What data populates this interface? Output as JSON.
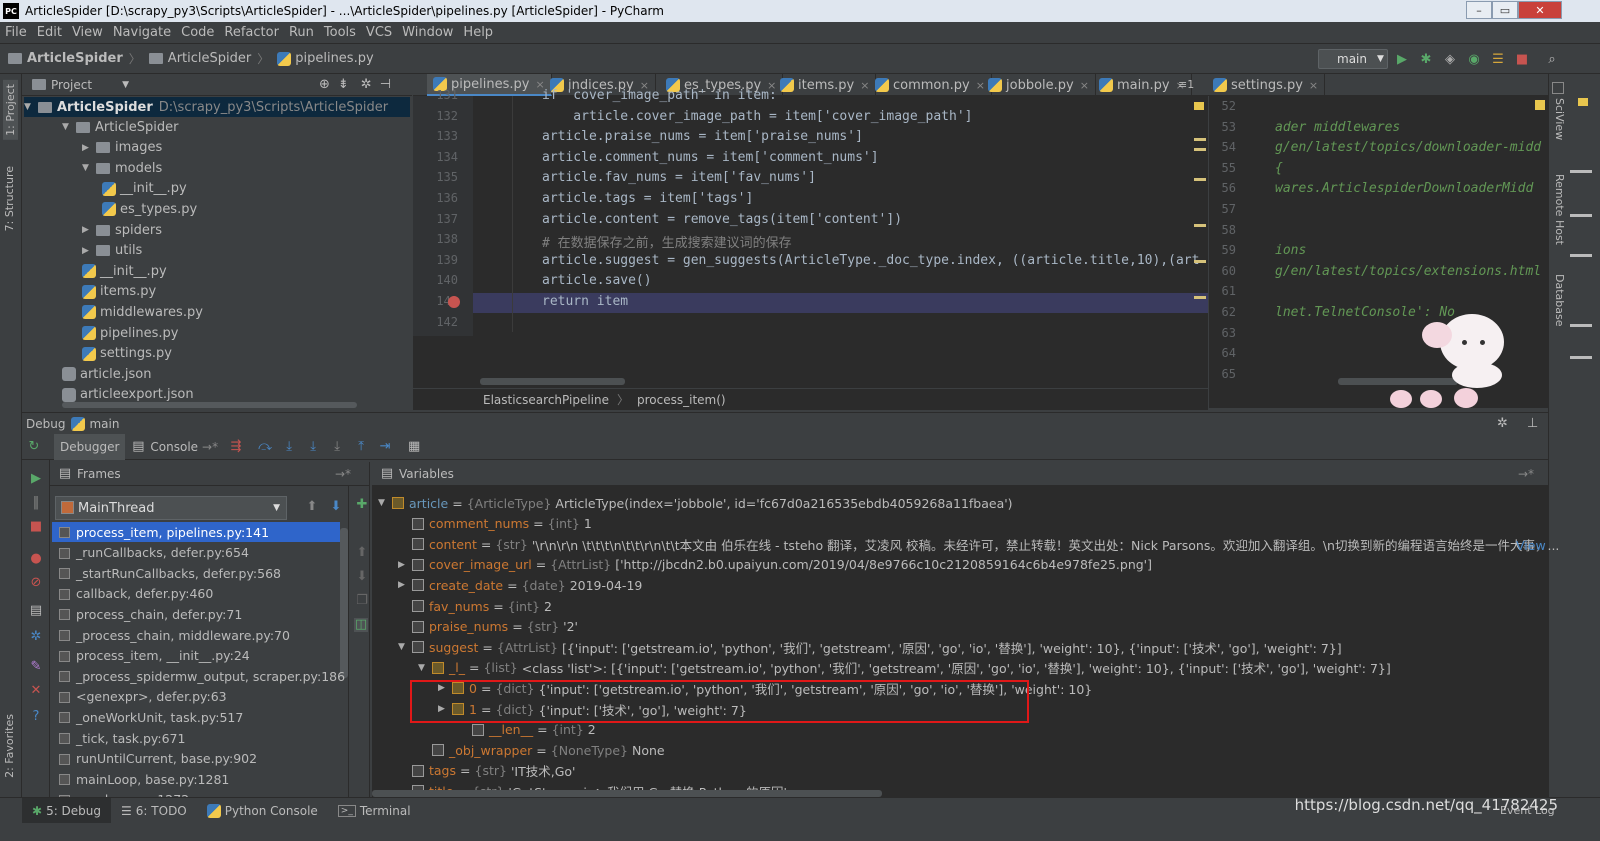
{
  "window": {
    "title": "ArticleSpider [D:\\scrapy_py3\\Scripts\\ArticleSpider] - ...\\ArticleSpider\\pipelines.py [ArticleSpider] - PyCharm",
    "logo": "PC"
  },
  "menu": [
    "File",
    "Edit",
    "View",
    "Navigate",
    "Code",
    "Refactor",
    "Run",
    "Tools",
    "VCS",
    "Window",
    "Help"
  ],
  "breadcrumb": [
    "ArticleSpider",
    "ArticleSpider",
    "pipelines.py"
  ],
  "run_config": "main",
  "left_tool_tabs": [
    "1: Project",
    "7: Structure",
    "2: Favorites"
  ],
  "right_tool_tabs": [
    "SciView",
    "Remote Host",
    "Database"
  ],
  "project": {
    "header": "Project",
    "root_name": "ArticleSpider",
    "root_path": "D:\\scrapy_py3\\Scripts\\ArticleSpider",
    "items": [
      {
        "name": "ArticleSpider",
        "kind": "folder",
        "expanded": true
      },
      {
        "name": "images",
        "kind": "folder",
        "expanded": false
      },
      {
        "name": "models",
        "kind": "folder",
        "expanded": true
      },
      {
        "name": "__init__.py",
        "kind": "py"
      },
      {
        "name": "es_types.py",
        "kind": "py"
      },
      {
        "name": "spiders",
        "kind": "folder",
        "expanded": false
      },
      {
        "name": "utils",
        "kind": "folder",
        "expanded": false
      },
      {
        "name": "__init__.py",
        "kind": "py"
      },
      {
        "name": "items.py",
        "kind": "py"
      },
      {
        "name": "middlewares.py",
        "kind": "py"
      },
      {
        "name": "pipelines.py",
        "kind": "py"
      },
      {
        "name": "settings.py",
        "kind": "py"
      },
      {
        "name": "article.json",
        "kind": "json"
      },
      {
        "name": "articleexport.json",
        "kind": "json"
      }
    ]
  },
  "editor_tabs": [
    "pipelines.py",
    "indices.py",
    "es_types.py",
    "items.py",
    "common.py",
    "jobbole.py",
    "main.py",
    "settings.py"
  ],
  "editor_tabs_overflow": "1",
  "code": {
    "lines": [
      {
        "num": "131",
        "text": "if 'cover_image_path' in item:"
      },
      {
        "num": "132",
        "text": "    article.cover_image_path = item['cover_image_path']"
      },
      {
        "num": "133",
        "text": "article.praise_nums = item['praise_nums']"
      },
      {
        "num": "134",
        "text": "article.comment_nums = item['comment_nums']"
      },
      {
        "num": "135",
        "text": "article.fav_nums = item['fav_nums']"
      },
      {
        "num": "136",
        "text": "article.tags = item['tags']"
      },
      {
        "num": "137",
        "text": "article.content = remove_tags(item['content'])"
      },
      {
        "num": "138",
        "text": "# 在数据保存之前，生成搜索建议词的保存"
      },
      {
        "num": "139",
        "text": "article.suggest = gen_suggests(ArticleType._doc_type.index, ((article.title,10),(art"
      },
      {
        "num": "140",
        "text": "article.save()"
      },
      {
        "num": "141",
        "text": "return item"
      },
      {
        "num": "142",
        "text": ""
      }
    ],
    "breadcrumb": [
      "ElasticsearchPipeline",
      "process_item()"
    ]
  },
  "right_code": {
    "lines": [
      {
        "num": "52",
        "text": ""
      },
      {
        "num": "53",
        "text": "ader middlewares"
      },
      {
        "num": "54",
        "text": "g/en/latest/topics/downloader-midd"
      },
      {
        "num": "55",
        "text": "{"
      },
      {
        "num": "56",
        "text": "wares.ArticlespiderDownloaderMidd"
      },
      {
        "num": "57",
        "text": ""
      },
      {
        "num": "58",
        "text": ""
      },
      {
        "num": "59",
        "text": "ions"
      },
      {
        "num": "60",
        "text": "g/en/latest/topics/extensions.html"
      },
      {
        "num": "61",
        "text": ""
      },
      {
        "num": "62",
        "text": "lnet.TelnetConsole': No"
      },
      {
        "num": "63",
        "text": ""
      },
      {
        "num": "64",
        "text": ""
      },
      {
        "num": "65",
        "text": ""
      }
    ]
  },
  "debug": {
    "title": "Debug",
    "config": "main",
    "tabs": [
      "Debugger",
      "Console"
    ],
    "frames_header": "Frames",
    "variables_header": "Variables",
    "thread": "MainThread",
    "frames": [
      "process_item, pipelines.py:141",
      "_runCallbacks, defer.py:654",
      "_startRunCallbacks, defer.py:568",
      "callback, defer.py:460",
      "process_chain, defer.py:71",
      "_process_chain, middleware.py:70",
      "process_item, __init__.py:24",
      "_process_spidermw_output, scraper.py:186",
      "<genexpr>, defer.py:63",
      "_oneWorkUnit, task.py:517",
      "_tick, task.py:671",
      "runUntilCurrent, base.py:902",
      "mainLoop, base.py:1281",
      "run, base.py:1272"
    ],
    "variables": [
      {
        "name": "article",
        "type": "{ArticleType}",
        "value": "ArticleType(index='jobbole', id='fc67d0a216535ebdb4059268a11fbaea')"
      },
      {
        "name": "comment_nums",
        "type": "{int}",
        "value": "1"
      },
      {
        "name": "content",
        "type": "{str}",
        "value": "'\\r\\n\\r\\n            \\t\\t\\t\\n\\t\\t\\r\\n\\t\\t本文由 伯乐在线 - tsteho 翻译，艾凌风 校稿。未经许可，禁止转载！英文出处：Nick Parsons。欢迎加入翻译组。\\n切换到新的编程语言始终是一件大事，..."
      },
      {
        "name": "cover_image_url",
        "type": "{AttrList}",
        "value": "['http://jbcdn2.b0.upaiyun.com/2019/04/8e9766c10c2120859164c6b4e978fe25.png']"
      },
      {
        "name": "create_date",
        "type": "{date}",
        "value": "2019-04-19"
      },
      {
        "name": "fav_nums",
        "type": "{int}",
        "value": "2"
      },
      {
        "name": "praise_nums",
        "type": "{str}",
        "value": "'2'"
      },
      {
        "name": "suggest",
        "type": "{AttrList}",
        "value": "[{'input': ['getstream.io', 'python', '我们', 'getstream', '原因', 'go', 'io', '替换'], 'weight': 10}, {'input': ['技术', 'go'], 'weight': 7}]"
      },
      {
        "name": "_l_",
        "type": "{list}",
        "value": "<class 'list'>: [{'input': ['getstream.io', 'python', '我们', 'getstream', '原因', 'go', 'io', '替换'], 'weight': 10}, {'input': ['技术', 'go'], 'weight': 7}]"
      },
      {
        "name": "0",
        "type": "{dict}",
        "value": "{'input': ['getstream.io', 'python', '我们', 'getstream', '原因', 'go', 'io', '替换'], 'weight': 10}"
      },
      {
        "name": "1",
        "type": "{dict}",
        "value": "{'input': ['技术', 'go'], 'weight': 7}"
      },
      {
        "name": "__len__",
        "type": "{int}",
        "value": "2"
      },
      {
        "name": "_obj_wrapper",
        "type": "{NoneType}",
        "value": "None"
      },
      {
        "name": "tags",
        "type": "{str}",
        "value": "'IT技术,Go'"
      },
      {
        "name": "title",
        "type": "{str}",
        "value": "'GetStream.io：我们用 Go 替换 Python 的原因'"
      }
    ],
    "view_link": "View"
  },
  "bottom_tabs": [
    "5: Debug",
    "6: TODO",
    "Python Console",
    "Terminal"
  ],
  "event_log": "Event Log",
  "watermark": "https://blog.csdn.net/qq_41782425",
  "colors": {
    "accent": "#4a88c7",
    "selection": "#2f65ca",
    "highlight_box": "#e01818",
    "run": "#59a869"
  }
}
